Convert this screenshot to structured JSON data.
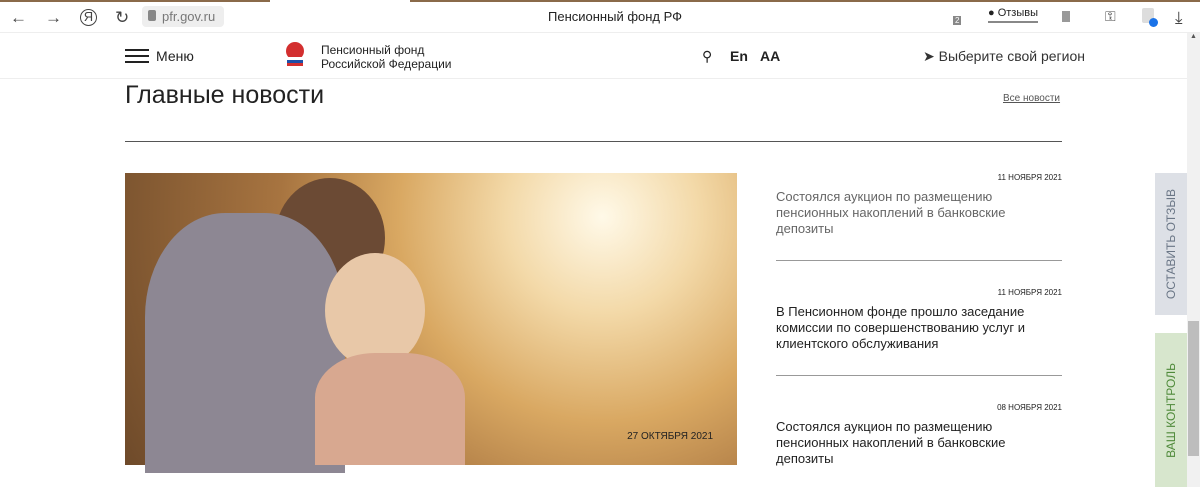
{
  "browser": {
    "url": "pfr.gov.ru",
    "title": "Пенсионный фонд РФ",
    "reviews": "Отзывы",
    "tabs_count": "2"
  },
  "header": {
    "menu": "Меню",
    "brand_line1": "Пенсионный фонд",
    "brand_line2": "Российской Федерации",
    "lang": "En",
    "font_size": "AA",
    "region": "Выберите свой регион"
  },
  "main": {
    "title": "Главные новости",
    "all_news": "Все новости",
    "featured_date": "27 ОКТЯБРЯ 2021",
    "news": [
      {
        "date": "11 НОЯБРЯ 2021",
        "title": "Состоялся аукцион по размещению пенсионных накоплений в банковские депозиты"
      },
      {
        "date": "11 НОЯБРЯ 2021",
        "title": "В Пенсионном фонде прошло заседание комиссии по совершенствованию услуг и клиентского обслуживания"
      },
      {
        "date": "08 НОЯБРЯ 2021",
        "title": "Состоялся аукцион по размещению пенсионных накоплений в банковские депозиты"
      }
    ]
  },
  "side": {
    "feedback": "ОСТАВИТЬ ОТЗЫВ",
    "control": "ВАШ КОНТРОЛЬ"
  }
}
